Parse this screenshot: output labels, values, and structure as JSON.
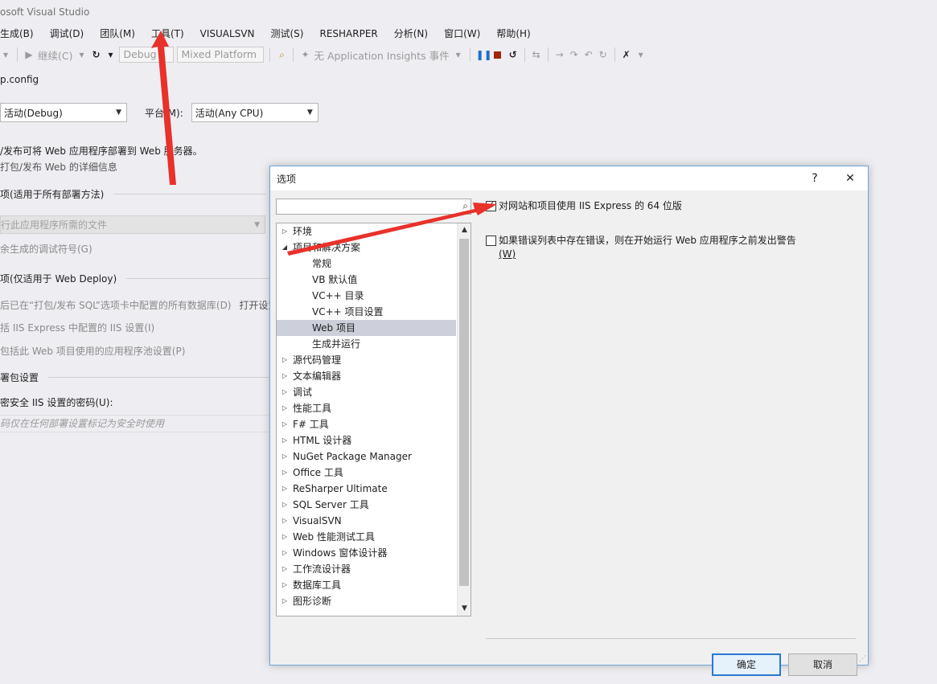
{
  "window": {
    "title": "osoft Visual Studio"
  },
  "menu": [
    "生成(B)",
    "调试(D)",
    "团队(M)",
    "工具(T)",
    "VISUALSVN",
    "测试(S)",
    "RESHARPER",
    "分析(N)",
    "窗口(W)",
    "帮助(H)"
  ],
  "toolbar": {
    "continue_label": "继续(C)",
    "config": "Debug",
    "platform": "Mixed Platform",
    "insights": "无 Application Insights 事件"
  },
  "doc_tab": "p.config",
  "config_row": {
    "config_value": "活动(Debug)",
    "platform_label": "平台(M):",
    "platform_value": "活动(Any CPU)"
  },
  "background": {
    "desc1": "/发布可将 Web 应用程序部署到 Web 服务器。",
    "desc2": "打包/发布 Web 的详细信息",
    "section1": "项(适用于所有部署方法)",
    "select_value": "行此应用程序所需的文件",
    "debug_symbols": "余生成的调试符号(G)",
    "section2": "项(仅适用于 Web Deploy)",
    "db_line": "后已在“打包/发布 SQL”选项卡中配置的所有数据库(D)",
    "db_open": "打开设置",
    "iis_line": "括 IIS Express 中配置的 IIS 设置(I)",
    "pool_line": "包括此 Web 项目使用的应用程序池设置(P)",
    "section3": "署包设置",
    "pwd_label": "密安全 IIS 设置的密码(U):",
    "pwd_placeholder": "码仅在任何部署设置标记为安全时使用"
  },
  "dialog": {
    "title": "选项",
    "help": "?",
    "close": "✕",
    "search_placeholder": "",
    "tree": [
      {
        "label": "环境",
        "level": 0,
        "expanded": false
      },
      {
        "label": "项目和解决方案",
        "level": 0,
        "expanded": true
      },
      {
        "label": "常规",
        "level": 1
      },
      {
        "label": "VB 默认值",
        "level": 1
      },
      {
        "label": "VC++ 目录",
        "level": 1
      },
      {
        "label": "VC++ 项目设置",
        "level": 1
      },
      {
        "label": "Web 项目",
        "level": 1,
        "selected": true
      },
      {
        "label": "生成并运行",
        "level": 1
      },
      {
        "label": "源代码管理",
        "level": 0,
        "expanded": false
      },
      {
        "label": "文本编辑器",
        "level": 0,
        "expanded": false
      },
      {
        "label": "调试",
        "level": 0,
        "expanded": false
      },
      {
        "label": "性能工具",
        "level": 0,
        "expanded": false
      },
      {
        "label": "F# 工具",
        "level": 0,
        "expanded": false
      },
      {
        "label": "HTML 设计器",
        "level": 0,
        "expanded": false
      },
      {
        "label": "NuGet Package Manager",
        "level": 0,
        "expanded": false
      },
      {
        "label": "Office 工具",
        "level": 0,
        "expanded": false
      },
      {
        "label": "ReSharper Ultimate",
        "level": 0,
        "expanded": false
      },
      {
        "label": "SQL Server 工具",
        "level": 0,
        "expanded": false
      },
      {
        "label": "VisualSVN",
        "level": 0,
        "expanded": false
      },
      {
        "label": "Web 性能测试工具",
        "level": 0,
        "expanded": false
      },
      {
        "label": "Windows 窗体设计器",
        "level": 0,
        "expanded": false
      },
      {
        "label": "工作流设计器",
        "level": 0,
        "expanded": false
      },
      {
        "label": "数据库工具",
        "level": 0,
        "expanded": false
      },
      {
        "label": "图形诊断",
        "level": 0,
        "expanded": false
      }
    ],
    "options": [
      {
        "label": "对网站和项目使用 IIS Express 的 64 位版",
        "checked": true
      },
      {
        "label": "如果错误列表中存在错误，则在开始运行 Web 应用程序之前发出警告",
        "label2": "(W)",
        "checked": false
      }
    ],
    "ok": "确定",
    "cancel": "取消"
  },
  "colors": {
    "accent": "#2b78d1",
    "annotation_arrow": "#e8312a"
  }
}
